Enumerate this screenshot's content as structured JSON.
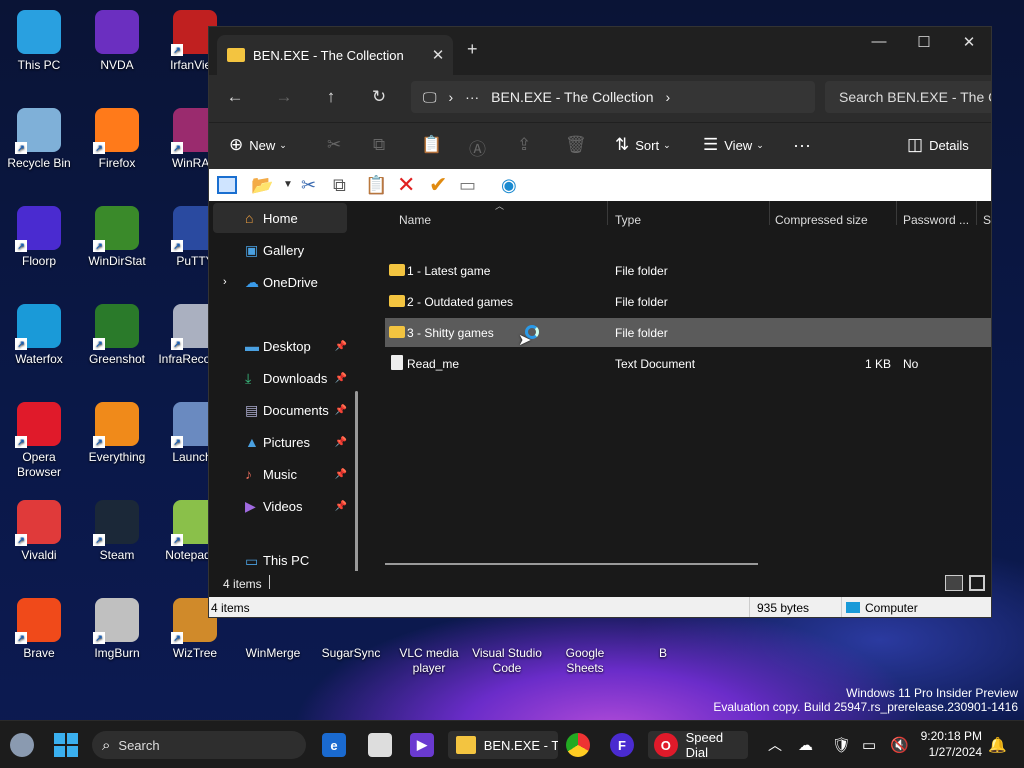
{
  "desktop": {
    "icons": [
      {
        "label": "This PC",
        "icon": "monitor-icon",
        "color": "#29a0e0"
      },
      {
        "label": "NVDA",
        "icon": "nvda-icon",
        "color": "#6b2fc0"
      },
      {
        "label": "IrfanView",
        "icon": "irfanview-icon",
        "color": "#c02020"
      },
      {
        "label": "Recycle Bin",
        "icon": "recycle-bin-icon",
        "color": "#7fb0d8"
      },
      {
        "label": "Firefox",
        "icon": "firefox-icon",
        "color": "#ff7a1a"
      },
      {
        "label": "WinRAR",
        "icon": "winrar-icon",
        "color": "#9a2b6e"
      },
      {
        "label": "Floorp",
        "icon": "floorp-icon",
        "color": "#4a2bd0"
      },
      {
        "label": "WinDirStat",
        "icon": "windirstat-icon",
        "color": "#3a8a2a"
      },
      {
        "label": "PuTTY",
        "icon": "putty-icon",
        "color": "#2a4aa0"
      },
      {
        "label": "Waterfox",
        "icon": "waterfox-icon",
        "color": "#1a9ad8"
      },
      {
        "label": "Greenshot",
        "icon": "greenshot-icon",
        "color": "#2a7a2a"
      },
      {
        "label": "InfraRecorder",
        "icon": "infrarecorder-icon",
        "color": "#aab0c0"
      },
      {
        "label": "Opera Browser",
        "icon": "opera-icon",
        "color": "#e01a2a"
      },
      {
        "label": "Everything",
        "icon": "everything-icon",
        "color": "#f08a1a"
      },
      {
        "label": "Launchy",
        "icon": "launchy-icon",
        "color": "#6a8ac0"
      },
      {
        "label": "Vivaldi",
        "icon": "vivaldi-icon",
        "color": "#e03a3a"
      },
      {
        "label": "Steam",
        "icon": "steam-icon",
        "color": "#1b2838"
      },
      {
        "label": "Notepad++",
        "icon": "notepadpp-icon",
        "color": "#8ac04a"
      },
      {
        "label": "Brave",
        "icon": "brave-icon",
        "color": "#f04a1a"
      },
      {
        "label": "ImgBurn",
        "icon": "imgburn-icon",
        "color": "#c0c0c0"
      },
      {
        "label": "WizTree",
        "icon": "wiztree-icon",
        "color": "#d08a2a"
      }
    ],
    "bottom_icons": [
      {
        "label": "WinMerge",
        "icon": "winmerge-icon"
      },
      {
        "label": "SugarSync",
        "icon": "sugarsync-icon"
      },
      {
        "label": "VLC media player",
        "icon": "vlc-icon"
      },
      {
        "label": "Visual Studio Code",
        "icon": "vscode-icon"
      },
      {
        "label": "Google Sheets",
        "icon": "sheets-icon"
      },
      {
        "label": "B",
        "icon": "file-icon"
      }
    ]
  },
  "explorer": {
    "tab_title": "BEN.EXE - The Collection",
    "address": {
      "crumb": "BEN.EXE - The Collection",
      "more": "···"
    },
    "search_placeholder": "Search BEN.EXE - The Collection",
    "commands": {
      "new": "New",
      "sort": "Sort",
      "view": "View",
      "more": "···",
      "details": "Details"
    },
    "nav": {
      "home": "Home",
      "gallery": "Gallery",
      "onedrive": "OneDrive",
      "desktop": "Desktop",
      "downloads": "Downloads",
      "documents": "Documents",
      "pictures": "Pictures",
      "music": "Music",
      "videos": "Videos",
      "thispc": "This PC"
    },
    "columns": {
      "name": "Name",
      "type": "Type",
      "compressed": "Compressed size",
      "password": "Password ...",
      "size": "Si"
    },
    "rows": [
      {
        "name": "1 - Latest game",
        "type": "File folder",
        "compressed": "",
        "password": ""
      },
      {
        "name": "2 - Outdated games",
        "type": "File folder",
        "compressed": "",
        "password": ""
      },
      {
        "name": "3 - Shitty games",
        "type": "File folder",
        "compressed": "",
        "password": ""
      },
      {
        "name": "Read_me",
        "type": "Text Document",
        "compressed": "1 KB",
        "password": "No"
      }
    ],
    "status": {
      "items": "4 items",
      "items2": "4 items",
      "bytes": "935 bytes",
      "location": "Computer"
    }
  },
  "watermark": {
    "line1": "Windows 11 Pro Insider Preview",
    "line2": "Evaluation copy. Build 25947.rs_prerelease.230901-1416"
  },
  "taskbar": {
    "search": "Search",
    "explorer_label": "BEN.EXE - Th",
    "opera_label": "Speed Dial",
    "time": "9:20:18 PM",
    "date": "1/27/2024"
  }
}
